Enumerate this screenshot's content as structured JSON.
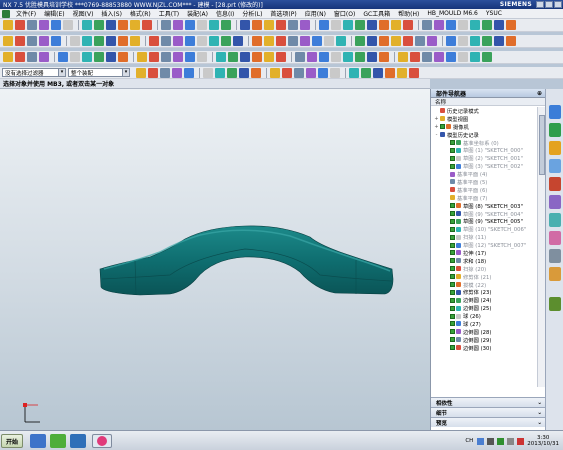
{
  "window": {
    "title": "NX 7.5 优胜模具培训学校  ***0769-88853880  WWW.NJZL.COM***  - 建模 - [28.prt  (修改的)]",
    "brand": "SIEMENS"
  },
  "menu": [
    "文件(F)",
    "编辑(E)",
    "视图(V)",
    "插入(S)",
    "格式(R)",
    "工具(T)",
    "装配(A)",
    "信息(I)",
    "分析(L)",
    "首选项(P)",
    "应用(N)",
    "窗口(O)",
    "GC工具箱",
    "帮助(H)",
    "HB_MOULD M6.6",
    "YSUC"
  ],
  "filterbar": {
    "filter_value": "没有选择过滤器",
    "assembly_value": "整个装配"
  },
  "cue_line": "选择对象并使用 MB3, 或者双击某一对象",
  "navigator": {
    "title": "部件导航器",
    "column": "名称",
    "items": [
      {
        "label": "历史记录模式",
        "level": 0,
        "exp": "",
        "cb": false,
        "dim": false
      },
      {
        "label": "模型视图",
        "level": 0,
        "exp": "+",
        "cb": false,
        "dim": false
      },
      {
        "label": "摄像机",
        "level": 0,
        "exp": "+",
        "cb": true,
        "dim": false
      },
      {
        "label": "模型历史记录",
        "level": 0,
        "exp": "-",
        "cb": false,
        "dim": false
      },
      {
        "label": "基准坐标系 (0)",
        "level": 1,
        "exp": "",
        "cb": true,
        "dim": true
      },
      {
        "label": "草图 (1) \"SKETCH_000\"",
        "level": 1,
        "exp": "",
        "cb": true,
        "dim": true
      },
      {
        "label": "草图 (2) \"SKETCH_001\"",
        "level": 1,
        "exp": "",
        "cb": true,
        "dim": true
      },
      {
        "label": "草图 (3) \"SKETCH_002\"",
        "level": 1,
        "exp": "",
        "cb": true,
        "dim": true
      },
      {
        "label": "基准平面 (4)",
        "level": 1,
        "exp": "",
        "cb": false,
        "dim": true
      },
      {
        "label": "基准平面 (5)",
        "level": 1,
        "exp": "",
        "cb": false,
        "dim": true
      },
      {
        "label": "基准平面 (6)",
        "level": 1,
        "exp": "",
        "cb": false,
        "dim": true
      },
      {
        "label": "基准平面 (7)",
        "level": 1,
        "exp": "",
        "cb": false,
        "dim": true
      },
      {
        "label": "草图 (8) \"SKETCH_003\"",
        "level": 1,
        "exp": "",
        "cb": true,
        "dim": false
      },
      {
        "label": "草图 (9) \"SKETCH_004\"",
        "level": 1,
        "exp": "",
        "cb": true,
        "dim": true
      },
      {
        "label": "草图 (9) \"SKETCH_005\"",
        "level": 1,
        "exp": "",
        "cb": true,
        "dim": false
      },
      {
        "label": "草图 (10) \"SKETCH_006\"",
        "level": 1,
        "exp": "",
        "cb": true,
        "dim": true
      },
      {
        "label": "扫掠 (11)",
        "level": 1,
        "exp": "",
        "cb": true,
        "dim": true
      },
      {
        "label": "草图 (12) \"SKETCH_007\"",
        "level": 1,
        "exp": "",
        "cb": true,
        "dim": true
      },
      {
        "label": "拉伸 (17)",
        "level": 1,
        "exp": "",
        "cb": true,
        "dim": false
      },
      {
        "label": "求和 (18)",
        "level": 1,
        "exp": "",
        "cb": true,
        "dim": false
      },
      {
        "label": "扫掠 (20)",
        "level": 1,
        "exp": "",
        "cb": true,
        "dim": true
      },
      {
        "label": "修剪体 (21)",
        "level": 1,
        "exp": "",
        "cb": true,
        "dim": true
      },
      {
        "label": "拔模 (22)",
        "level": 1,
        "exp": "",
        "cb": true,
        "dim": true
      },
      {
        "label": "修剪体 (23)",
        "level": 1,
        "exp": "",
        "cb": true,
        "dim": false
      },
      {
        "label": "边倒圆 (24)",
        "level": 1,
        "exp": "",
        "cb": true,
        "dim": false
      },
      {
        "label": "边倒圆 (25)",
        "level": 1,
        "exp": "",
        "cb": true,
        "dim": false
      },
      {
        "label": "球 (26)",
        "level": 1,
        "exp": "",
        "cb": true,
        "dim": false
      },
      {
        "label": "球 (27)",
        "level": 1,
        "exp": "",
        "cb": true,
        "dim": false
      },
      {
        "label": "边倒圆 (28)",
        "level": 1,
        "exp": "",
        "cb": true,
        "dim": false
      },
      {
        "label": "边倒圆 (29)",
        "level": 1,
        "exp": "",
        "cb": true,
        "dim": false
      },
      {
        "label": "边倒圆 (30)",
        "level": 1,
        "exp": "",
        "cb": true,
        "dim": false
      }
    ],
    "panels": [
      "相依性",
      "细节",
      "预览"
    ]
  },
  "taskbar": {
    "start": "开始",
    "lang": "CH",
    "time": "3:30",
    "date": "2013/10/31"
  },
  "colors": {
    "model": "#0f6e70",
    "titlebar": "#1f3f8c"
  }
}
